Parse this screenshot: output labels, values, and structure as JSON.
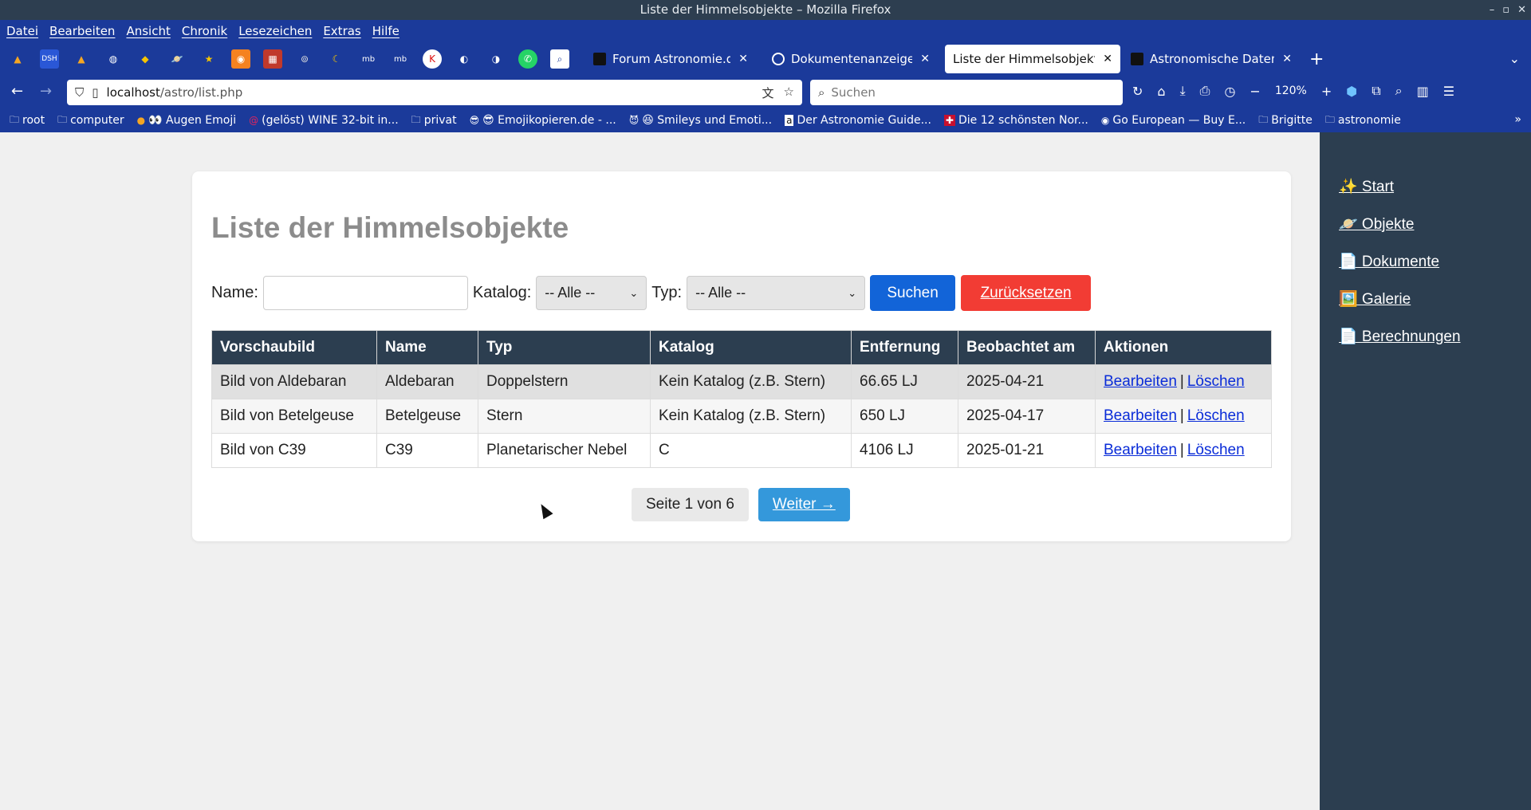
{
  "window": {
    "title": "Liste der Himmelsobjekte – Mozilla Firefox"
  },
  "menu": [
    "Datei",
    "Bearbeiten",
    "Ansicht",
    "Chronik",
    "Lesezeichen",
    "Extras",
    "Hilfe"
  ],
  "quick_icons": [
    "DSH"
  ],
  "tabs": [
    {
      "label": "Forum Astronomie.de",
      "active": false
    },
    {
      "label": "Dokumentenanzeige anp",
      "active": false
    },
    {
      "label": "Liste der Himmelsobjekte",
      "active": true
    },
    {
      "label": "Astronomische Datenban",
      "active": false
    }
  ],
  "nav": {
    "url_host": "localhost",
    "url_path": "/astro/list.php",
    "search_placeholder": "Suchen",
    "zoom": "120%"
  },
  "bookmarks": [
    {
      "label": "root",
      "icon": "folder-icon"
    },
    {
      "label": "computer",
      "icon": "folder-icon"
    },
    {
      "label": "👀 Augen Emoji",
      "icon": "emoji-icon"
    },
    {
      "label": "(gelöst) WINE 32-bit in...",
      "icon": "debian-icon"
    },
    {
      "label": "privat",
      "icon": "folder-icon"
    },
    {
      "label": "😎 Emojikopieren.de - ...",
      "icon": "emoji-icon"
    },
    {
      "label": "😆 Smileys und Emoti...",
      "icon": "emoji-icon"
    },
    {
      "label": "Der Astronomie Guide...",
      "icon": "amazon-icon"
    },
    {
      "label": "Die 12 schönsten Nor...",
      "icon": "flag-icon"
    },
    {
      "label": "Go European — Buy E...",
      "icon": "eu-icon"
    },
    {
      "label": "Brigitte",
      "icon": "folder-icon"
    },
    {
      "label": "astronomie",
      "icon": "folder-icon"
    }
  ],
  "page": {
    "title": "Liste der Himmelsobjekte",
    "filters": {
      "name_label": "Name:",
      "name_value": "",
      "catalog_label": "Katalog:",
      "catalog_selected": "-- Alle --",
      "type_label": "Typ:",
      "type_selected": "-- Alle --",
      "search_button": "Suchen",
      "reset_button": "Zurücksetzen"
    },
    "table": {
      "headers": [
        "Vorschaubild",
        "Name",
        "Typ",
        "Katalog",
        "Entfernung",
        "Beobachtet am",
        "Aktionen"
      ],
      "rows": [
        {
          "preview": "Bild von Aldebaran",
          "name": "Aldebaran",
          "type": "Doppelstern",
          "catalog": "Kein Katalog (z.B. Stern)",
          "distance": "66.65 LJ",
          "observed": "2025-04-21",
          "edit": "Bearbeiten",
          "sep": "|",
          "delete": "Löschen"
        },
        {
          "preview": "Bild von Betelgeuse",
          "name": "Betelgeuse",
          "type": "Stern",
          "catalog": "Kein Katalog (z.B. Stern)",
          "distance": "650 LJ",
          "observed": "2025-04-17",
          "edit": "Bearbeiten",
          "sep": "|",
          "delete": "Löschen"
        },
        {
          "preview": "Bild von C39",
          "name": "C39",
          "type": "Planetarischer Nebel",
          "catalog": "C",
          "distance": "4106 LJ",
          "observed": "2025-01-21",
          "edit": "Bearbeiten",
          "sep": "|",
          "delete": "Löschen"
        }
      ]
    },
    "pagination": {
      "info": "Seite 1 von 6",
      "next": "Weiter →"
    }
  },
  "sidebar": {
    "items": [
      {
        "label": "✨ Start"
      },
      {
        "label": "🪐 Objekte"
      },
      {
        "label": "📄 Dokumente"
      },
      {
        "label": "🖼️ Galerie"
      },
      {
        "label": "📄 Berechnungen"
      }
    ]
  },
  "colors": {
    "browser_chrome": "#1b3a9a",
    "table_header": "#2c3e50",
    "sidebar": "#2c3e50",
    "search_button": "#1264d8",
    "reset_button": "#f23c34",
    "next_button": "#3498db",
    "link": "#0a2cd8"
  }
}
